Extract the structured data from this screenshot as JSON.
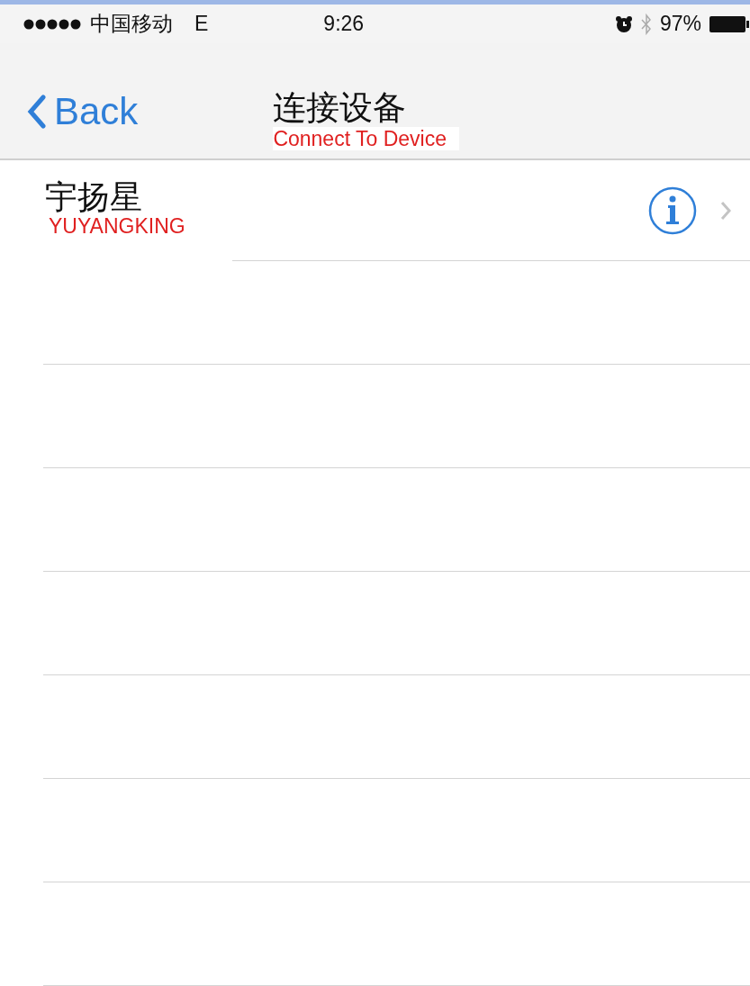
{
  "status_bar": {
    "carrier": "中国移动",
    "network": "E",
    "time": "9:26",
    "battery": "97%"
  },
  "nav_bar": {
    "back": "Back",
    "title": "连接设备",
    "title_note": "Connect To Device"
  },
  "devices": [
    {
      "name": "宇扬星",
      "note": "YUYANGKING"
    }
  ]
}
